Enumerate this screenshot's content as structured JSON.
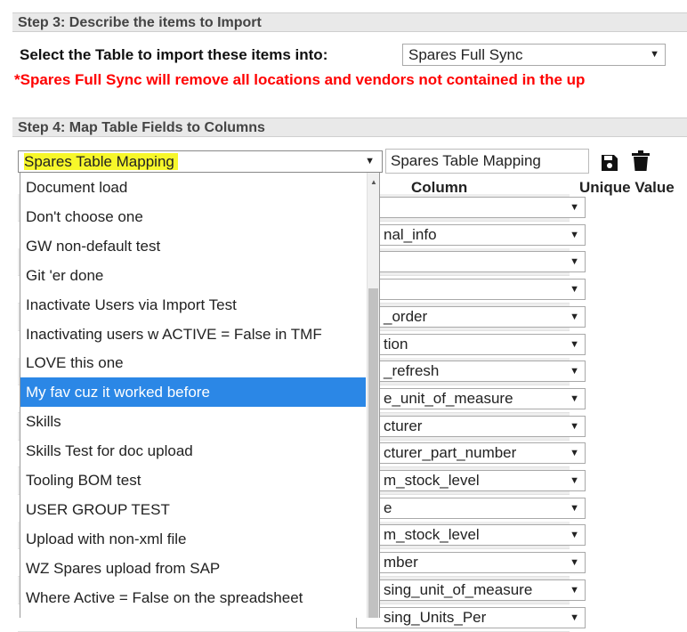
{
  "step3": {
    "header": "Step 3: Describe the items to Import",
    "select_label": "Select the Table to import these items into:",
    "table_value": "Spares Full Sync",
    "warning": "*Spares Full Sync will remove all locations and vendors not contained in the up"
  },
  "step4": {
    "header": "Step 4: Map Table Fields to Columns",
    "mapping_value": "Spares Table Mapping",
    "mapping_name": "Spares Table Mapping",
    "icons": {
      "save": "save-icon",
      "delete": "trash-icon"
    },
    "columns": {
      "column": "Column",
      "unique": "Unique Value"
    }
  },
  "field_rows": [
    "",
    "nal_info",
    "",
    "",
    "_order",
    "tion",
    "_refresh",
    "e_unit_of_measure",
    "cturer",
    "cturer_part_number",
    "m_stock_level",
    "e",
    "m_stock_level",
    "mber",
    "sing_unit_of_measure",
    "sing_Units_Per"
  ],
  "dropdown_options": [
    "Document load",
    "Don't choose one",
    "GW non-default test",
    "Git 'er done",
    "Inactivate Users via Import Test",
    "Inactivating users w ACTIVE = False in TMF",
    "LOVE this one",
    "My fav cuz it worked before",
    "Skills",
    "Skills Test for doc upload",
    "Tooling BOM test",
    "USER GROUP TEST",
    "Upload with non-xml file",
    "WZ Spares upload from SAP",
    "Where Active = False on the spreadsheet"
  ],
  "selected_option_index": 7,
  "colors": {
    "highlight": "#f7f72a",
    "selected": "#2b87e6",
    "warning": "#ff0000"
  }
}
